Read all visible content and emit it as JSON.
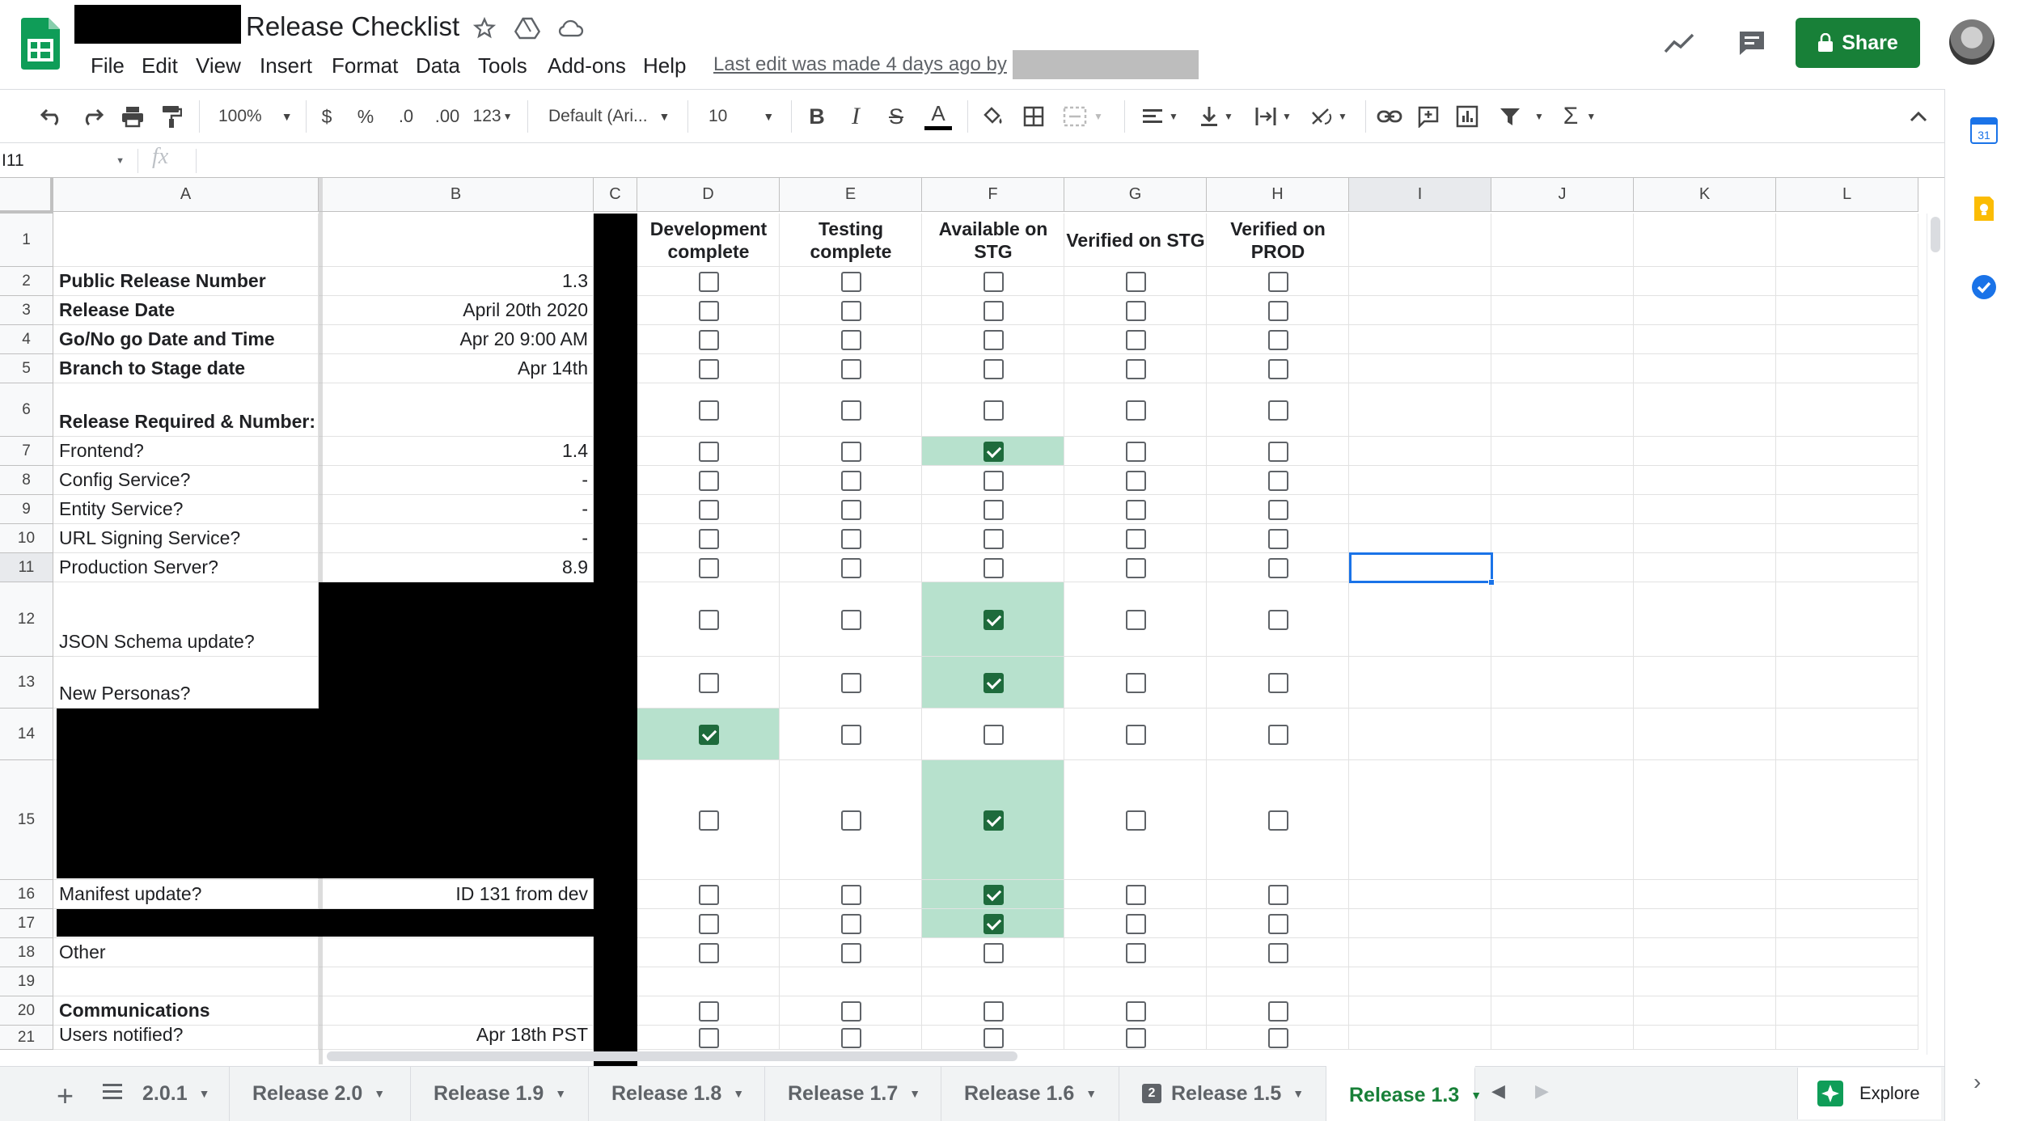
{
  "doc": {
    "title": "Release Checklist",
    "last_edit": "Last edit was made 4 days ago by",
    "share_label": "Share"
  },
  "menu": [
    "File",
    "Edit",
    "View",
    "Insert",
    "Format",
    "Data",
    "Tools",
    "Add-ons",
    "Help"
  ],
  "toolbar": {
    "zoom": "100%",
    "currency": "$",
    "percent": "%",
    "dec_less": ".0",
    "dec_more": ".00",
    "format_more": "123",
    "font": "Default (Ari...",
    "font_size": "10",
    "bold": "B",
    "italic": "I",
    "strike": "S",
    "text_color": "A"
  },
  "formula_bar": {
    "cell_ref": "I11",
    "fx": "fx",
    "content": ""
  },
  "columns": [
    "A",
    "B",
    "C",
    "D",
    "E",
    "F",
    "G",
    "H",
    "I",
    "J",
    "K",
    "L"
  ],
  "status_headers": {
    "D": "Development complete",
    "E": "Testing complete",
    "F": "Available on STG",
    "G": "Verified on STG",
    "H": "Verified on PROD"
  },
  "rows": [
    {
      "n": "1",
      "a": "",
      "b": "",
      "bold": false,
      "checks": null
    },
    {
      "n": "2",
      "a": "Public Release Number",
      "b": "1.3",
      "bold": true,
      "checks": [
        0,
        0,
        0,
        0,
        0
      ]
    },
    {
      "n": "3",
      "a": "Release Date",
      "b": "April 20th 2020",
      "bold": true,
      "checks": [
        0,
        0,
        0,
        0,
        0
      ]
    },
    {
      "n": "4",
      "a": "Go/No go Date and Time",
      "b": "Apr 20 9:00 AM",
      "bold": true,
      "checks": [
        0,
        0,
        0,
        0,
        0
      ]
    },
    {
      "n": "5",
      "a": "Branch to Stage date",
      "b": "Apr 14th",
      "bold": true,
      "checks": [
        0,
        0,
        0,
        0,
        0
      ]
    },
    {
      "n": "6",
      "a": "Release Required & Number:",
      "b": "",
      "bold": true,
      "checks": [
        0,
        0,
        0,
        0,
        0
      ]
    },
    {
      "n": "7",
      "a": "Frontend?",
      "b": "1.4",
      "bold": false,
      "checks": [
        0,
        0,
        1,
        0,
        0
      ]
    },
    {
      "n": "8",
      "a": "Config Service?",
      "b": "-",
      "bold": false,
      "checks": [
        0,
        0,
        0,
        0,
        0
      ]
    },
    {
      "n": "9",
      "a": "Entity Service?",
      "b": "-",
      "bold": false,
      "checks": [
        0,
        0,
        0,
        0,
        0
      ]
    },
    {
      "n": "10",
      "a": "URL Signing Service?",
      "b": "-",
      "bold": false,
      "checks": [
        0,
        0,
        0,
        0,
        0
      ]
    },
    {
      "n": "11",
      "a": "Production Server?",
      "b": "8.9",
      "bold": false,
      "checks": [
        0,
        0,
        0,
        0,
        0
      ]
    },
    {
      "n": "12",
      "a": "JSON Schema update?",
      "b": "",
      "bold": false,
      "checks": [
        0,
        0,
        1,
        0,
        0
      ]
    },
    {
      "n": "13",
      "a": "New Personas?",
      "b": "",
      "bold": false,
      "checks": [
        0,
        0,
        1,
        0,
        0
      ]
    },
    {
      "n": "14",
      "a": "",
      "b": "",
      "bold": false,
      "checks": [
        1,
        0,
        0,
        0,
        0
      ]
    },
    {
      "n": "15",
      "a": "",
      "b": "",
      "bold": false,
      "checks": [
        0,
        0,
        1,
        0,
        0
      ]
    },
    {
      "n": "16",
      "a": "Manifest update?",
      "b": "ID 131 from dev",
      "bold": false,
      "checks": [
        0,
        0,
        1,
        0,
        0
      ]
    },
    {
      "n": "17",
      "a": "",
      "b": "",
      "bold": false,
      "checks": [
        0,
        0,
        1,
        0,
        0
      ]
    },
    {
      "n": "18",
      "a": "Other",
      "b": "",
      "bold": false,
      "checks": [
        0,
        0,
        0,
        0,
        0
      ]
    },
    {
      "n": "19",
      "a": "",
      "b": "",
      "bold": false,
      "checks": null
    },
    {
      "n": "20",
      "a": "Communications",
      "b": "",
      "bold": true,
      "checks": [
        0,
        0,
        0,
        0,
        0
      ]
    },
    {
      "n": "21",
      "a": "Users notified?",
      "b": "Apr 18th PST",
      "bold": false,
      "checks": [
        0,
        0,
        0,
        0,
        0
      ]
    }
  ],
  "sheet_tabs": [
    "2.0.1",
    "Release 2.0",
    "Release 1.9",
    "Release 1.8",
    "Release 1.7",
    "Release 1.6",
    "Release 1.5",
    "Release 1.3"
  ],
  "active_tab": "Release 1.3",
  "tab_badge": "2",
  "explore_label": "Explore",
  "calendar_day": "31",
  "colors": {
    "green_fill": "#b7e1cd",
    "check": "#1e6b3c",
    "share": "#188038",
    "select": "#1a73e8"
  }
}
